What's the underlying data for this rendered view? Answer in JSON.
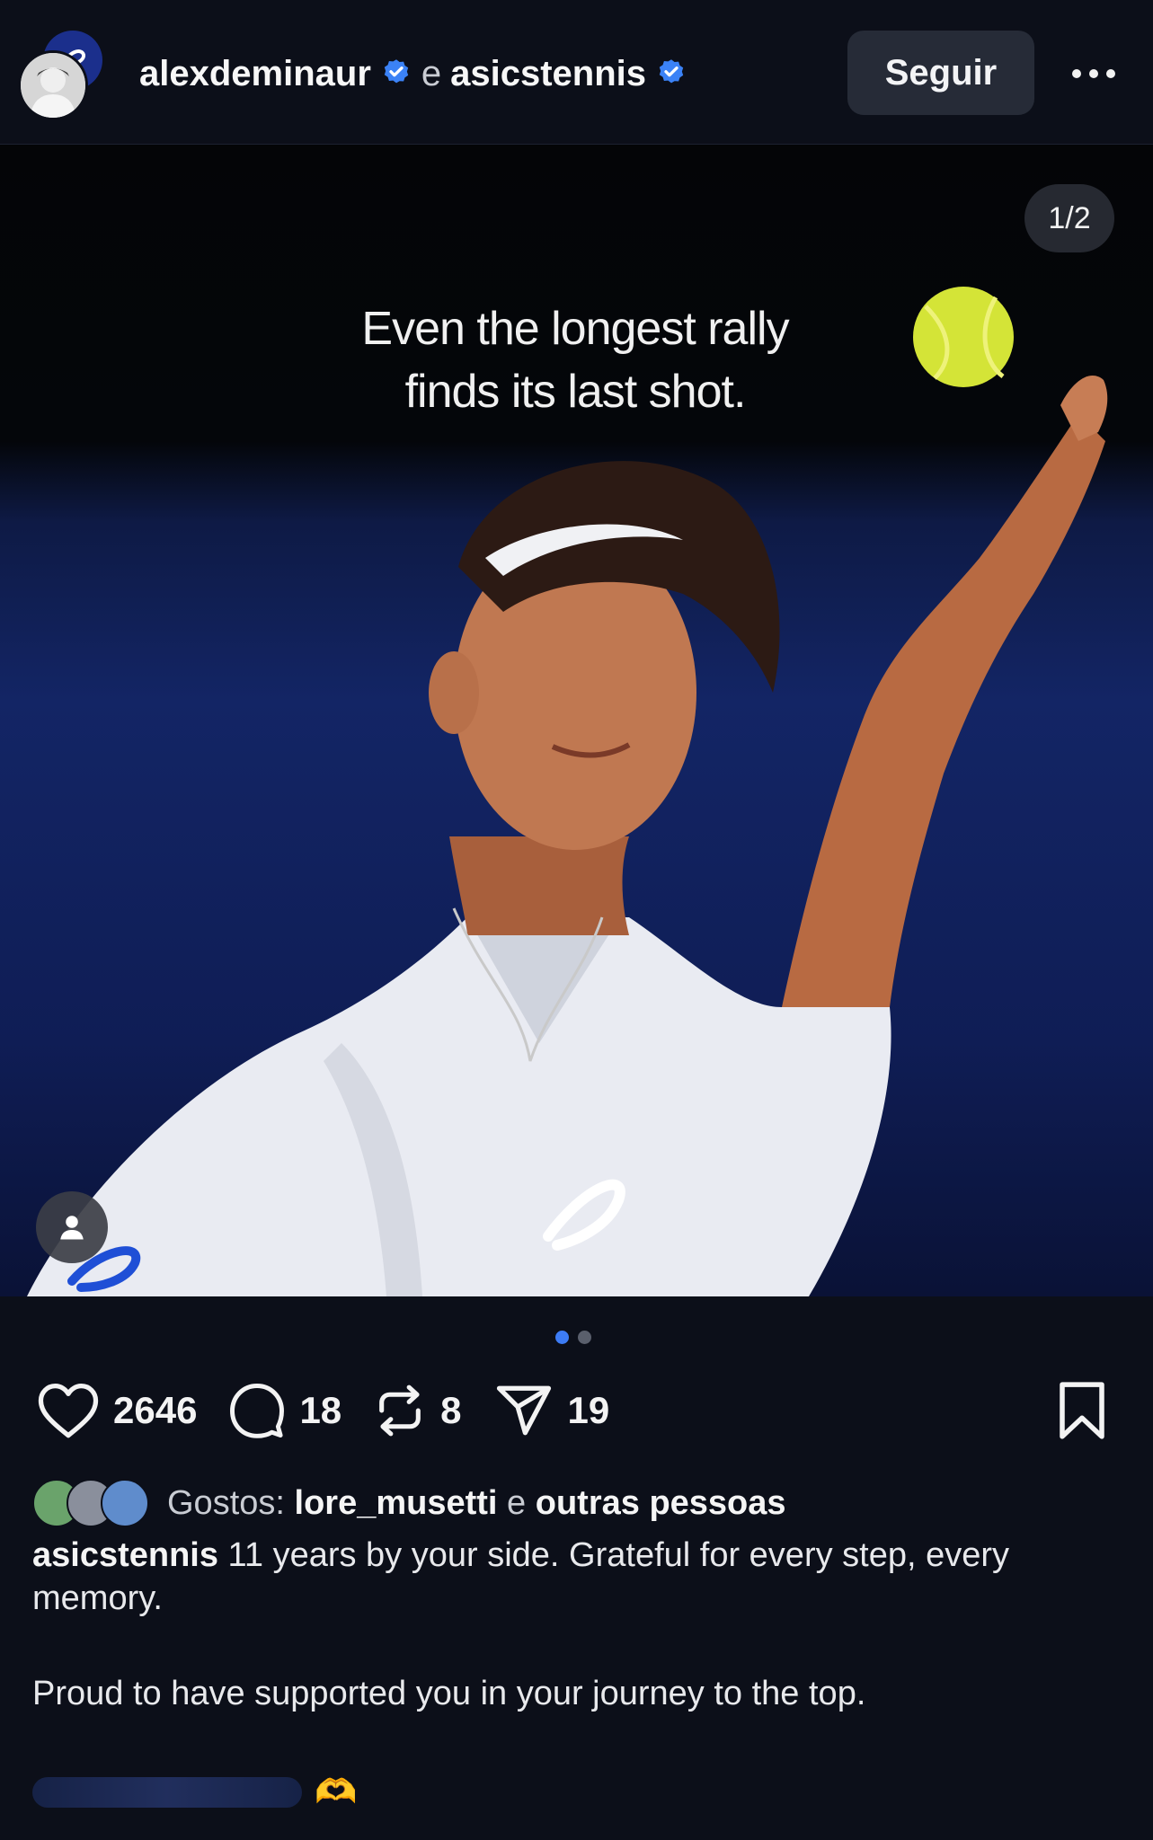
{
  "header": {
    "user1": "alexdeminaur",
    "conjunction": "e",
    "user2": "asicstennis",
    "follow_label": "Seguir",
    "more_label": "•••"
  },
  "media": {
    "counter": "1/2",
    "overlay_line1": "Even the longest rally",
    "overlay_line2": "finds its last shot."
  },
  "carousel": {
    "total": 2,
    "active": 1
  },
  "actions": {
    "likes": "2646",
    "comments": "18",
    "reposts": "8",
    "shares": "19"
  },
  "likes_line": {
    "prefix": "Gostos:",
    "user": "lore_musetti",
    "conjunction": "e",
    "others": "outras pessoas"
  },
  "caption": {
    "author": "asicstennis",
    "text1": " 11 years by your side. Grateful for every step, every memory.",
    "text2": "Proud to have supported you in your journey to the top."
  },
  "comment_preview": {
    "emoji": "🫶"
  },
  "colors": {
    "background": "#0c0f19",
    "verified": "#3b82f6",
    "button": "#262b37",
    "dot_active": "#3d7cf5"
  },
  "icons": [
    "heart-icon",
    "comment-icon",
    "repost-icon",
    "share-icon",
    "bookmark-icon",
    "verified-icon",
    "more-icon",
    "person-icon"
  ]
}
